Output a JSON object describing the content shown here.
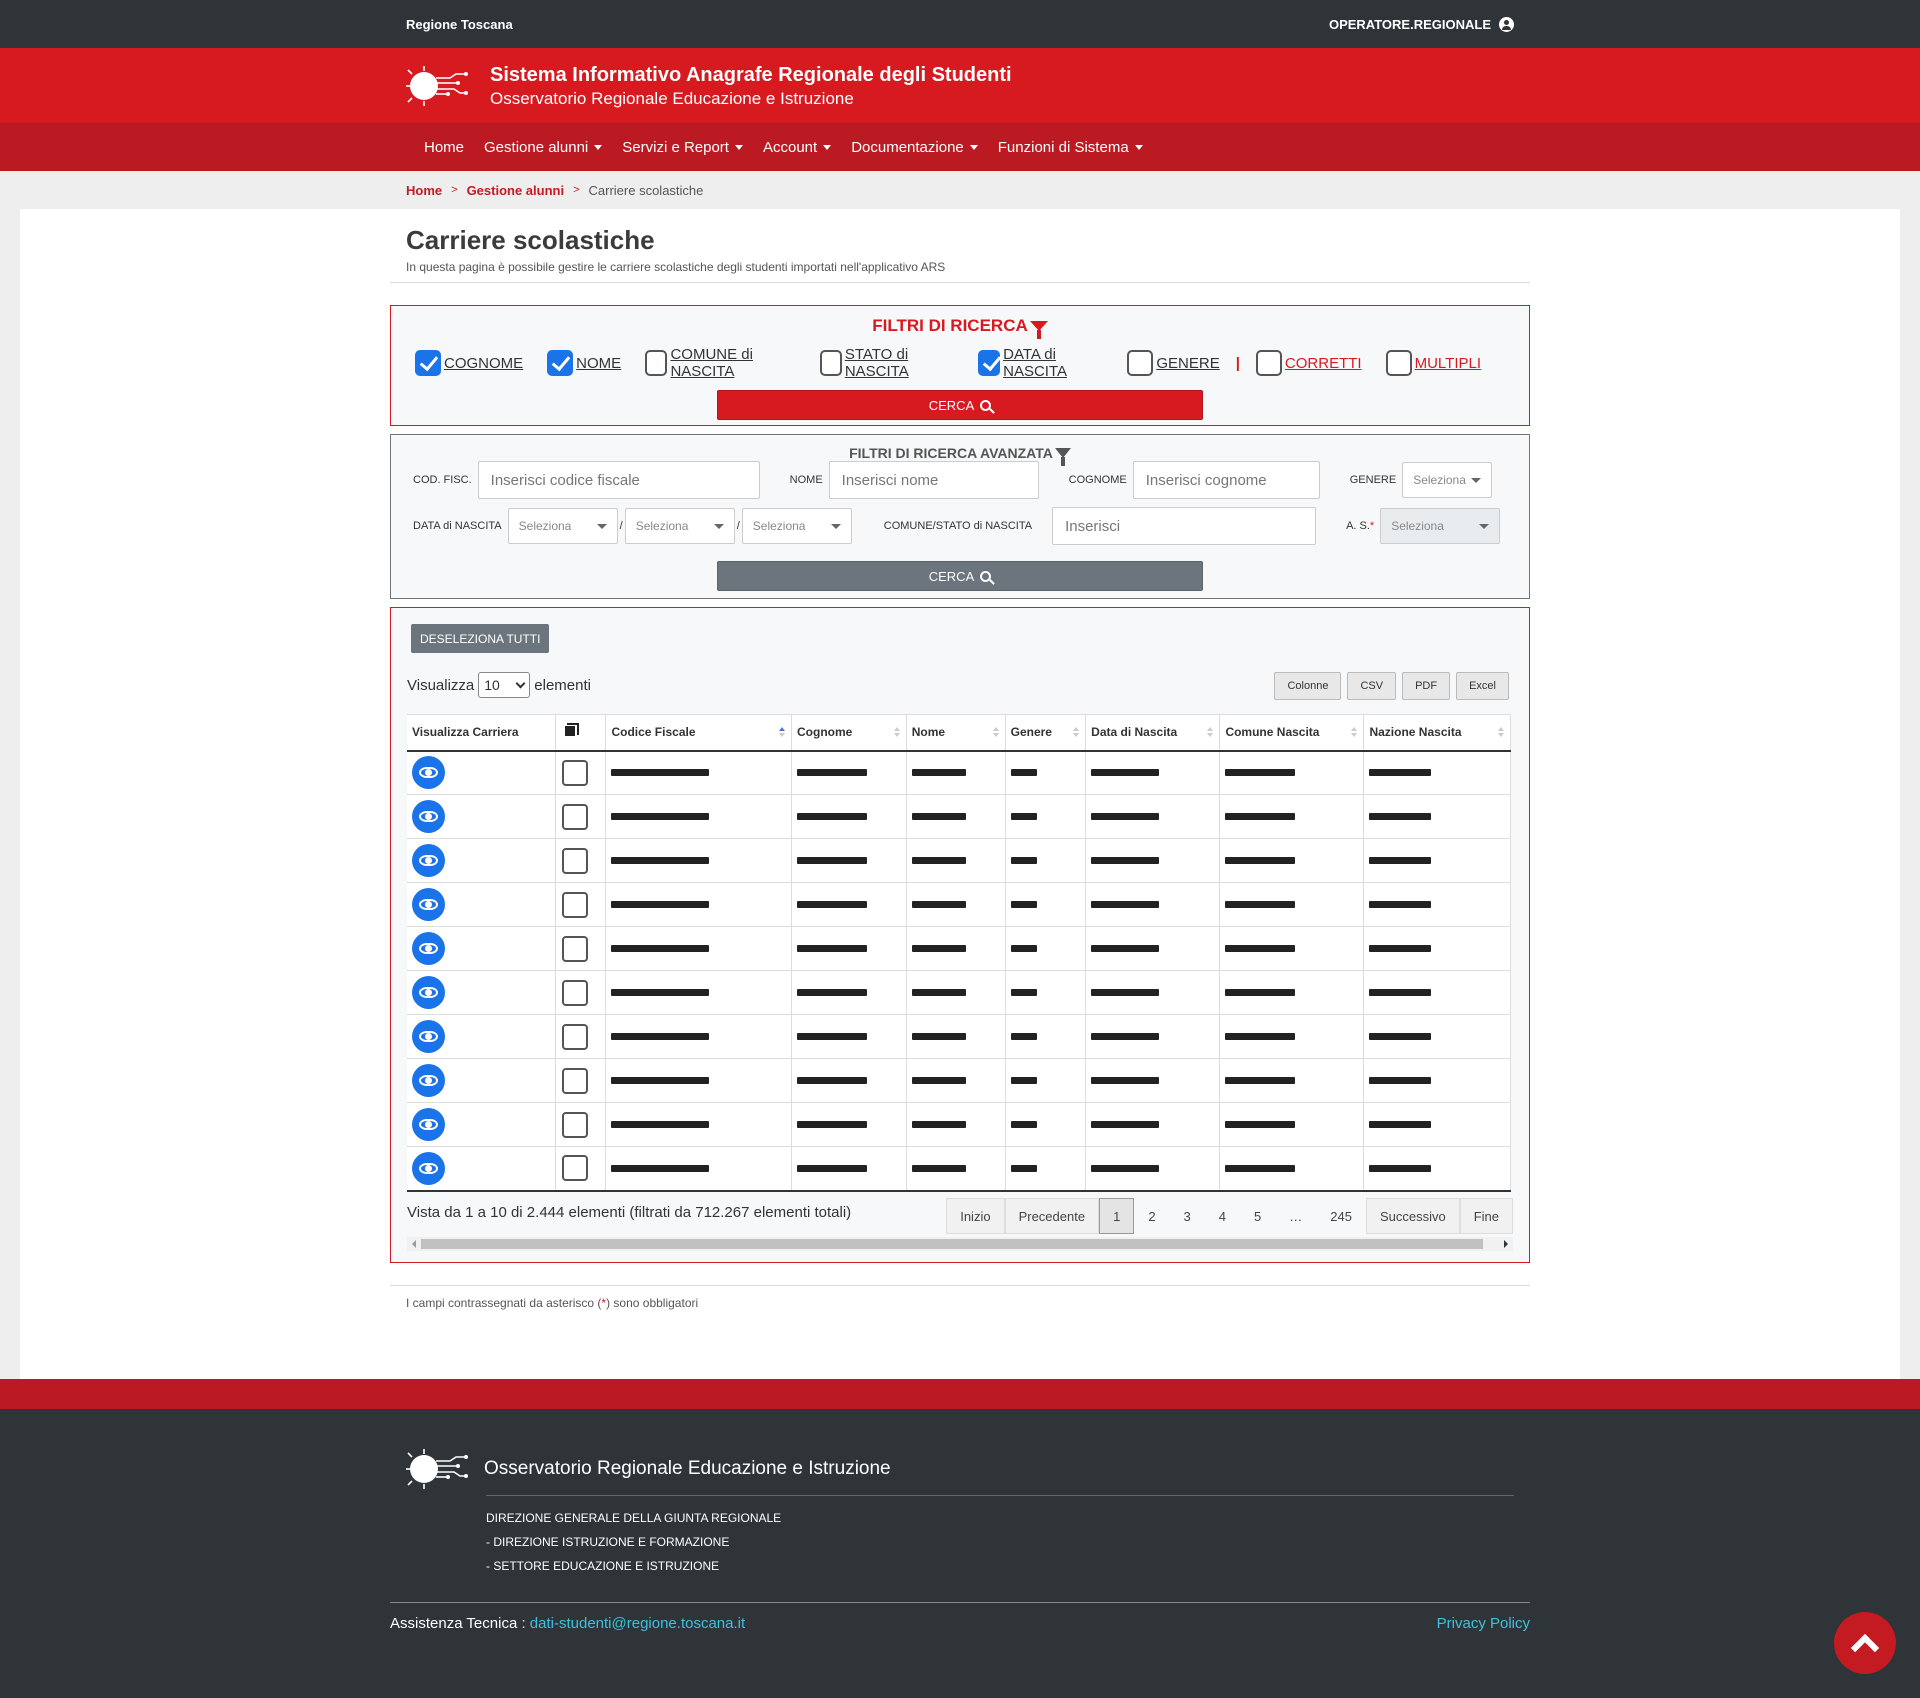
{
  "topbar": {
    "region": "Regione Toscana",
    "user": "OPERATORE.REGIONALE"
  },
  "header": {
    "title": "Sistema Informativo Anagrafe Regionale degli Studenti",
    "subtitle": "Osservatorio Regionale Educazione e Istruzione"
  },
  "nav": {
    "items": [
      {
        "label": "Home",
        "dropdown": false
      },
      {
        "label": "Gestione alunni",
        "dropdown": true
      },
      {
        "label": "Servizi e Report",
        "dropdown": true
      },
      {
        "label": "Account",
        "dropdown": true
      },
      {
        "label": "Documentazione",
        "dropdown": true
      },
      {
        "label": "Funzioni di Sistema",
        "dropdown": true
      }
    ]
  },
  "breadcrumb": {
    "home": "Home",
    "section": "Gestione alunni",
    "current": "Carriere scolastiche",
    "separator": ">"
  },
  "page": {
    "title": "Carriere scolastiche",
    "description": "In questa pagina è possibile gestire le carriere scolastiche degli studenti importati nell'applicativo ARS"
  },
  "filters": {
    "title": "FILTRI DI RICERCA",
    "checkboxes": [
      {
        "label": "COGNOME",
        "checked": true
      },
      {
        "label": "NOME",
        "checked": true
      },
      {
        "label": "COMUNE di NASCITA",
        "checked": false
      },
      {
        "label": "STATO di NASCITA",
        "checked": false
      },
      {
        "label": "DATA di NASCITA",
        "checked": true
      },
      {
        "label": "GENERE",
        "checked": false
      }
    ],
    "separator": "|",
    "extra": [
      {
        "label": "CORRETTI",
        "checked": false
      },
      {
        "label": "MULTIPLI",
        "checked": false
      }
    ],
    "search_label": "CERCA"
  },
  "advanced": {
    "title": "FILTRI DI RICERCA AVANZATA",
    "cod_fisc_label": "COD. FISC.",
    "cod_fisc_placeholder": "Inserisci codice fiscale",
    "nome_label": "NOME",
    "nome_placeholder": "Inserisci nome",
    "cognome_label": "COGNOME",
    "cognome_placeholder": "Inserisci cognome",
    "genere_label": "GENERE",
    "genere_value": "Seleziona",
    "data_label": "DATA di NASCITA",
    "data_day": "Seleziona",
    "data_month": "Seleziona",
    "data_year": "Seleziona",
    "date_sep": "/",
    "comune_label": "COMUNE/STATO di NASCITA",
    "comune_placeholder": "Inserisci",
    "as_label": "A. S.",
    "as_required": "*",
    "as_value": "Seleziona",
    "search_label": "CERCA"
  },
  "table": {
    "deselect_label": "DESELEZIONA TUTTI",
    "show_prefix": "Visualizza",
    "page_length": "10",
    "show_suffix": "elementi",
    "export_buttons": [
      "Colonne",
      "CSV",
      "PDF",
      "Excel"
    ],
    "columns": [
      "Visualizza Carriera",
      "",
      "Codice Fiscale",
      "Cognome",
      "Nome",
      "Genere",
      "Data di Nascita",
      "Comune Nascita",
      "Nazione Nascita"
    ],
    "sorted_column": "Codice Fiscale",
    "row_count": 10,
    "info": "Vista da 1 a 10 di 2.444 elementi (filtrati da 712.267 elementi totali)",
    "pagination": [
      "Inizio",
      "Precedente",
      "1",
      "2",
      "3",
      "4",
      "5",
      "…",
      "245",
      "Successivo",
      "Fine"
    ],
    "current_page": "1"
  },
  "note": {
    "before": "I campi contrassegnati da asterisco (",
    "star": "*",
    "after": ") sono obbligatori"
  },
  "footer": {
    "org": "Osservatorio Regionale Educazione e Istruzione",
    "lines": [
      "DIREZIONE GENERALE DELLA GIUNTA REGIONALE",
      "- DIREZIONE ISTRUZIONE E FORMAZIONE",
      "- SETTORE EDUCAZIONE E ISTRUZIONE"
    ],
    "support_label": "Assistenza Tecnica :",
    "support_email": "dati-studenti@regione.toscana.it",
    "privacy": "Privacy Policy"
  },
  "colors": {
    "primary_red": "#d71920",
    "dark_red": "#bb1a22",
    "dark_bg": "#2e3438",
    "accent_blue": "#1a73e8",
    "link_cyan": "#3fc0e0"
  }
}
